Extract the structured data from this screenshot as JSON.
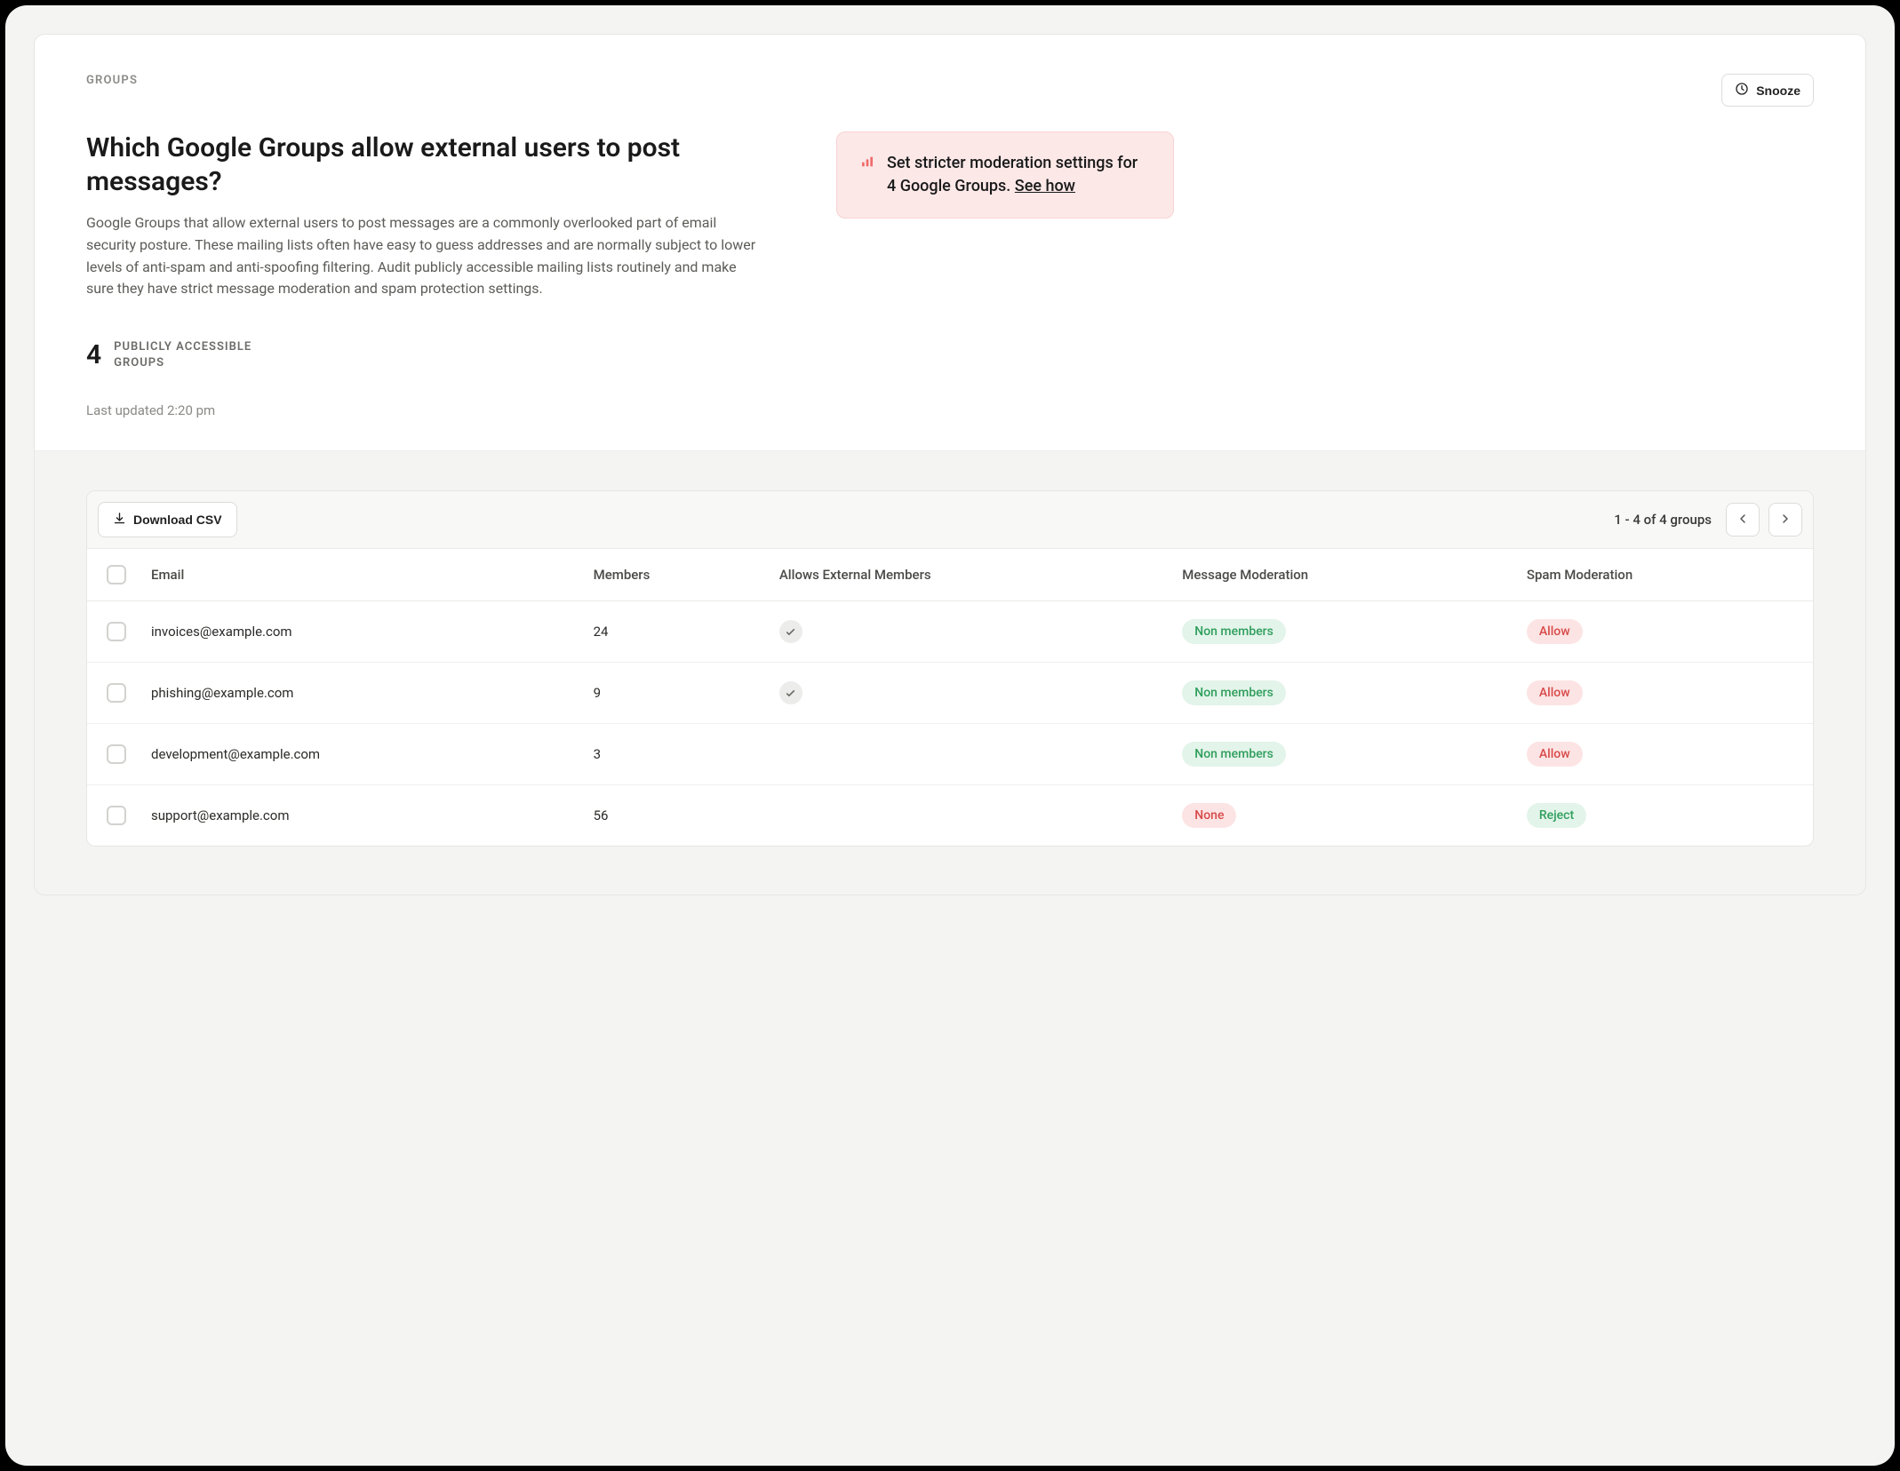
{
  "breadcrumb": "GROUPS",
  "snooze_label": "Snooze",
  "title": "Which Google Groups allow external users to post messages?",
  "description": "Google Groups that allow external users to post messages are a commonly overlooked part of email security posture. These mailing lists often have easy to guess addresses and are normally subject to lower levels of anti-spam and anti-spoofing filtering. Audit publicly accessible mailing lists routinely and make sure they have strict message moderation and spam protection settings.",
  "alert": {
    "text_prefix": "Set stricter moderation settings for 4 Google Groups.",
    "see_how": "See how"
  },
  "stat": {
    "number": "4",
    "label_line1": "PUBLICLY ACCESSIBLE",
    "label_line2": "GROUPS"
  },
  "last_updated": "Last updated 2:20 pm",
  "toolbar": {
    "download_label": "Download CSV",
    "pager_text": "1 - 4 of 4 groups"
  },
  "columns": {
    "email": "Email",
    "members": "Members",
    "allows_external": "Allows External Members",
    "message_moderation": "Message Moderation",
    "spam_moderation": "Spam Moderation"
  },
  "rows": [
    {
      "email": "invoices@example.com",
      "members": "24",
      "allows_external": true,
      "message_moderation": {
        "label": "Non members",
        "tone": "green"
      },
      "spam_moderation": {
        "label": "Allow",
        "tone": "red"
      }
    },
    {
      "email": "phishing@example.com",
      "members": "9",
      "allows_external": true,
      "message_moderation": {
        "label": "Non members",
        "tone": "green"
      },
      "spam_moderation": {
        "label": "Allow",
        "tone": "red"
      }
    },
    {
      "email": "development@example.com",
      "members": "3",
      "allows_external": false,
      "message_moderation": {
        "label": "Non members",
        "tone": "green"
      },
      "spam_moderation": {
        "label": "Allow",
        "tone": "red"
      }
    },
    {
      "email": "support@example.com",
      "members": "56",
      "allows_external": false,
      "message_moderation": {
        "label": "None",
        "tone": "red"
      },
      "spam_moderation": {
        "label": "Reject",
        "tone": "green"
      }
    }
  ]
}
